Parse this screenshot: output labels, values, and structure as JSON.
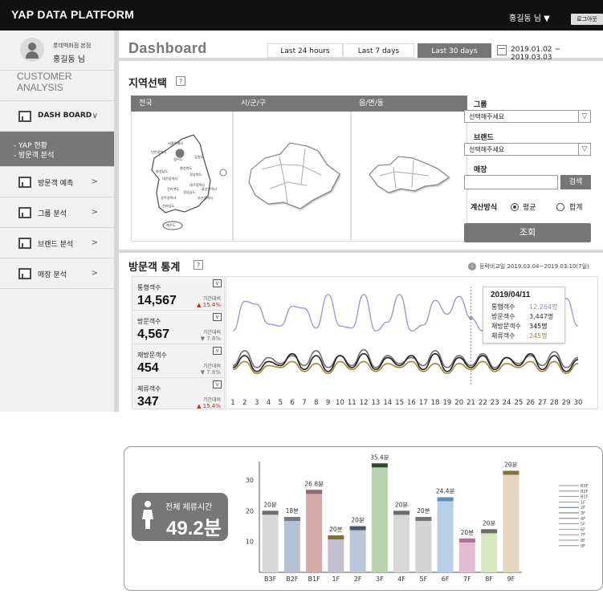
{
  "header": {
    "brand": "YAP DATA PLATFORM",
    "user_menu": "홍길동 님 ▼",
    "logout": "로그아웃"
  },
  "sidebar": {
    "store": "롯데백화점 본점",
    "username": "홍길동 님",
    "section_title": "CUSTOMER ANALYSIS",
    "items": [
      {
        "label": "DASH BOARD",
        "chevron": "∨"
      },
      {
        "label": "방문객 예측",
        "chevron": ">"
      },
      {
        "label": "그룹 분석",
        "chevron": ">"
      },
      {
        "label": "브랜드 분석",
        "chevron": ">"
      },
      {
        "label": "매장 분석",
        "chevron": ">"
      }
    ],
    "submenu": [
      "-  YAP 현황",
      "-  방문객 분석"
    ],
    "icon": "chart-icon"
  },
  "dashboard": {
    "title": "Dashboard",
    "ranges": [
      "Last 24 hours",
      "Last 7 days",
      "Last 30 days"
    ],
    "active_range": "Last 30 days",
    "date_range": "2019.01.02 ~ 2019.03.03"
  },
  "region": {
    "title": "지역선택",
    "help": "?",
    "columns": [
      "전국",
      "시/군/구",
      "읍/면/동"
    ],
    "national_labels": [
      "서울특별시",
      "인천광역시",
      "강원도",
      "경기도",
      "충청북도",
      "충청남도",
      "경상북도",
      "대전광역시",
      "대구광역시",
      "전라북도",
      "경상남도",
      "울산광역시",
      "광주광역시",
      "부산광역시",
      "전라남도",
      "제주도"
    ],
    "filters": {
      "group_label": "그룹",
      "group_value": "선택해주세요",
      "brand_label": "브랜드",
      "brand_value": "선택해주세요",
      "store_label": "매장",
      "search": "검색",
      "calc_label": "계산방식",
      "avg": "평균",
      "sum": "합계",
      "query": "조회"
    }
  },
  "visitor": {
    "title": "방문객 통계",
    "help": "?",
    "compare": "등락비교일 2019.03.04~2019.03.10(7일)",
    "stats": [
      {
        "name": "통행객수",
        "value": "14,567",
        "cmp": "기간대비",
        "change": "▲ 15.4%",
        "dir": "up"
      },
      {
        "name": "방문객수",
        "value": "4,567",
        "cmp": "기간대비",
        "change": "▼ 7.8%",
        "dir": "down"
      },
      {
        "name": "재방문객수",
        "value": "454",
        "cmp": "기간대비",
        "change": "▼ 7.8%",
        "dir": "down"
      },
      {
        "name": "체류객수",
        "value": "347",
        "cmp": "기간대비",
        "change": "▲ 15.4%",
        "dir": "up"
      }
    ],
    "tooltip": {
      "date": "2019/04/11",
      "rows": [
        {
          "label": "통행객수",
          "value": "12,264명"
        },
        {
          "label": "방문객수",
          "value": "3,447명"
        },
        {
          "label": "재방문객수",
          "value": "345명"
        },
        {
          "label": "체류객수",
          "value": "245명"
        }
      ]
    },
    "legend": [
      "통행객수",
      "방문객수",
      "재방문객수",
      "체류객수"
    ]
  },
  "dwell": {
    "title": "전체 체류시간",
    "value": "49.2분"
  },
  "chart_data": [
    {
      "type": "line",
      "x": [
        1,
        2,
        3,
        4,
        5,
        6,
        7,
        8,
        9,
        10,
        11,
        12,
        13,
        14,
        15,
        16,
        17,
        18,
        19,
        20,
        21,
        22,
        23,
        24,
        25,
        26,
        27,
        28,
        29,
        30
      ],
      "series": [
        {
          "name": "통행객수",
          "color": "#9b9ad2",
          "values": [
            55,
            85,
            82,
            62,
            60,
            80,
            78,
            58,
            92,
            60,
            58,
            92,
            55,
            64,
            92,
            55,
            61,
            86,
            72,
            90,
            68,
            55,
            73,
            90,
            60,
            70,
            80,
            52,
            88,
            60
          ]
        },
        {
          "name": "방문객수",
          "color": "#6e6e6e",
          "values": [
            20,
            35,
            18,
            28,
            22,
            30,
            20,
            35,
            18,
            30,
            20,
            36,
            18,
            30,
            22,
            28,
            20,
            35,
            18,
            30,
            20,
            32,
            18,
            28,
            22,
            30,
            20,
            34,
            18,
            28
          ]
        },
        {
          "name": "재방문객수",
          "color": "#1f1f1f",
          "values": [
            18,
            30,
            14,
            24,
            20,
            32,
            16,
            30,
            14,
            30,
            18,
            32,
            16,
            28,
            20,
            30,
            16,
            32,
            14,
            28,
            18,
            30,
            16,
            28,
            20,
            32,
            16,
            30,
            14,
            26
          ]
        },
        {
          "name": "체류객수",
          "color": "#9a8a38",
          "values": [
            16,
            24,
            12,
            20,
            18,
            24,
            14,
            22,
            12,
            24,
            16,
            24,
            14,
            22,
            18,
            24,
            14,
            22,
            12,
            22,
            16,
            24,
            14,
            22,
            18,
            24,
            14,
            24,
            12,
            22
          ]
        }
      ],
      "ylim": [
        0,
        100
      ],
      "tooltip_x": 21
    },
    {
      "type": "bar",
      "categories": [
        "B3F",
        "B2F",
        "B1F",
        "1F",
        "2F",
        "3F",
        "4F",
        "5F",
        "6F",
        "7F",
        "8F",
        "9F"
      ],
      "values": [
        20,
        18,
        26.8,
        12,
        15,
        35.4,
        20,
        18,
        24.4,
        11,
        14,
        33
      ],
      "labels": [
        "20분",
        "18분",
        "26.8분",
        "20분",
        "20분",
        "35.4분",
        "20분",
        "20분",
        "24.4분",
        "20분",
        "20분",
        "20분"
      ],
      "ylim": [
        0,
        36
      ],
      "yticks": [
        10,
        20,
        30
      ],
      "colors": [
        "#d9d9d9",
        "#b4c1d4",
        "#d6a9a9",
        "#c3bfcf",
        "#b8c8d8",
        "#b9d3b0",
        "#d8d8d8",
        "#d4d4d4",
        "#b8cfe8",
        "#e2bdd2",
        "#d7e5c1",
        "#e5d7bf"
      ],
      "cap_colors": [
        "#6d6d6d",
        "#727981",
        "#8a6d69",
        "#80712d",
        "#4c5964",
        "#2f4c2d",
        "#6c6c6c",
        "#777777",
        "#5e8db8",
        "#b36f98",
        "#6c6c6c",
        "#837344"
      ],
      "legend": [
        "B3F",
        "B2F",
        "B1F",
        "1F",
        "2F",
        "3F",
        "4F",
        "5F",
        "6F",
        "7F",
        "8F",
        "9F"
      ]
    }
  ]
}
